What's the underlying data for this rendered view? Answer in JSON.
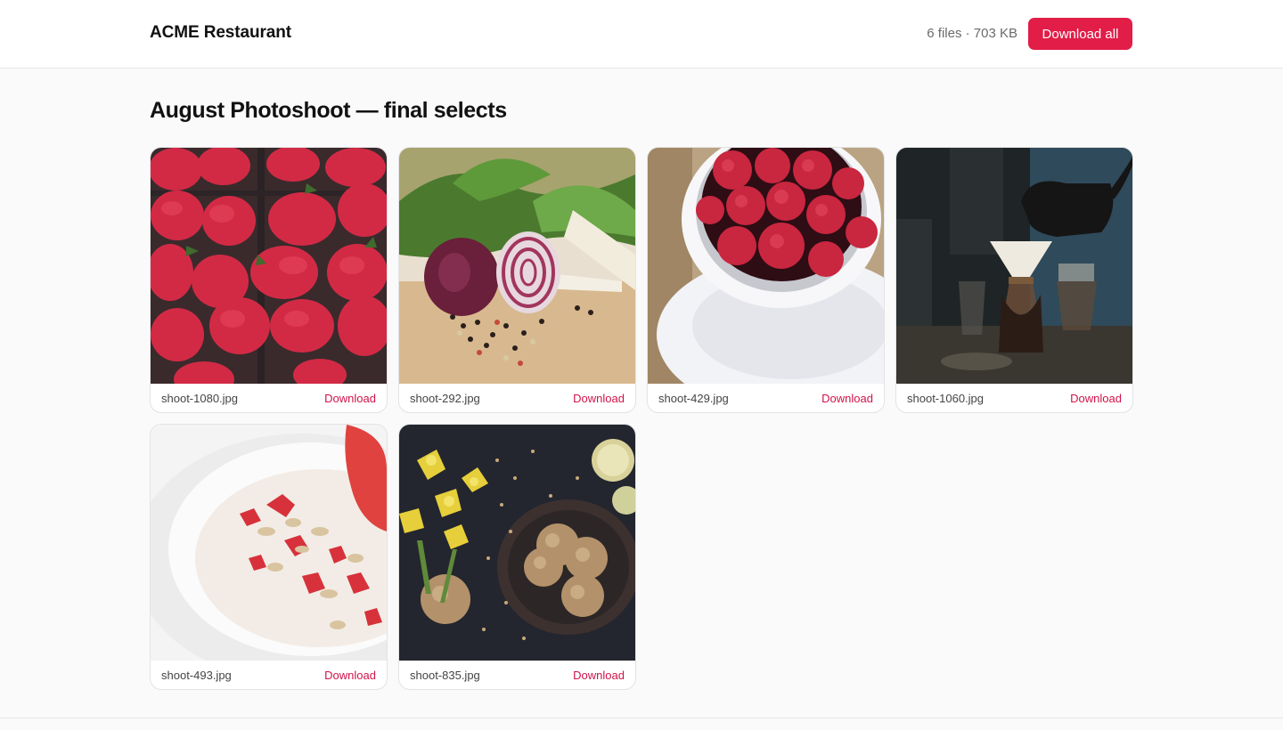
{
  "header": {
    "brand": "ACME Restaurant",
    "summary": "6 files · 703 KB",
    "download_all_label": "Download all"
  },
  "page": {
    "title": "August Photoshoot — final selects"
  },
  "colors": {
    "accent": "#e11d48",
    "link": "#d0134a"
  },
  "files": [
    {
      "name": "shoot-1080.jpg",
      "action": "Download",
      "subject": "strawberries"
    },
    {
      "name": "shoot-292.jpg",
      "action": "Download",
      "subject": "onion-and-herbs"
    },
    {
      "name": "shoot-429.jpg",
      "action": "Download",
      "subject": "raspberries-bowl"
    },
    {
      "name": "shoot-1060.jpg",
      "action": "Download",
      "subject": "pour-over-coffee"
    },
    {
      "name": "shoot-493.jpg",
      "action": "Download",
      "subject": "yogurt-strawberry-oats"
    },
    {
      "name": "shoot-835.jpg",
      "action": "Download",
      "subject": "cookies-and-daffodils"
    }
  ]
}
